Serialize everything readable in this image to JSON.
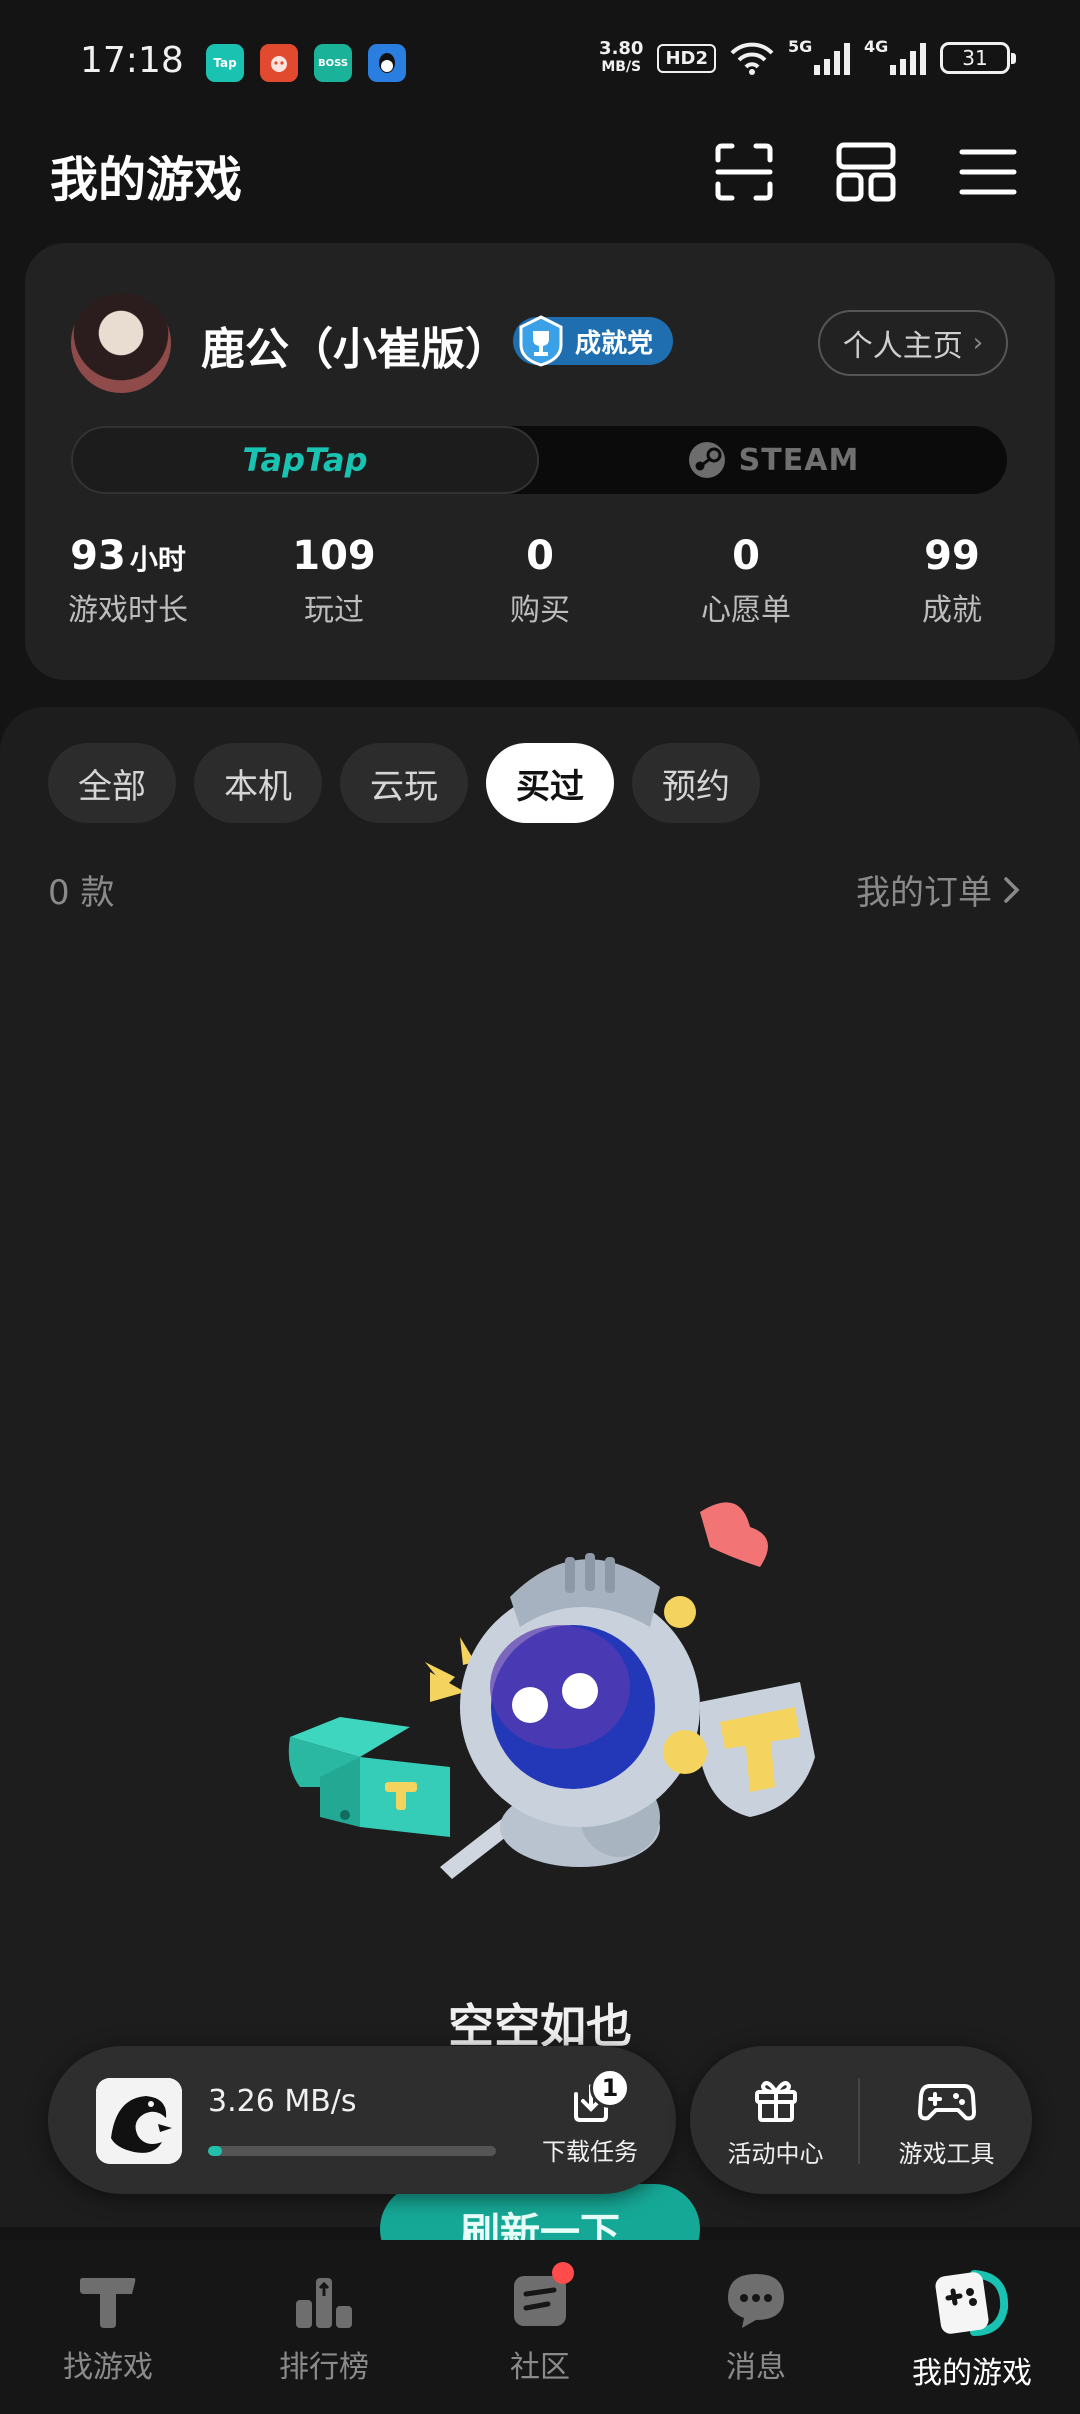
{
  "status_bar": {
    "time": "17:18",
    "apps": [
      {
        "name": "Tap",
        "color": "#19c2b1"
      },
      {
        "name": "",
        "color": "#e24a2f"
      },
      {
        "name": "BOSS",
        "color": "#1bb29a"
      },
      {
        "name": "",
        "color": "#2a7ee0"
      }
    ],
    "net_speed_value": "3.80",
    "net_speed_unit": "MB/S",
    "hd": "HD2",
    "signal_1": "5G",
    "signal_2": "4G",
    "battery": "31"
  },
  "header": {
    "title": "我的游戏",
    "icons": [
      "scan-icon",
      "grid-icon",
      "menu-icon"
    ]
  },
  "profile": {
    "username": "鹿公（小崔版）",
    "badge": "成就党",
    "homepage_button": "个人主页",
    "platforms": {
      "active": "TapTap",
      "inactive": "STEAM"
    },
    "stats": [
      {
        "value": "93",
        "unit": "小时",
        "label": "游戏时长"
      },
      {
        "value": "109",
        "unit": "",
        "label": "玩过"
      },
      {
        "value": "0",
        "unit": "",
        "label": "购买"
      },
      {
        "value": "0",
        "unit": "",
        "label": "心愿单"
      },
      {
        "value": "99",
        "unit": "",
        "label": "成就"
      }
    ]
  },
  "filters": {
    "tabs": [
      "全部",
      "本机",
      "云玩",
      "买过",
      "预约"
    ],
    "active": "买过"
  },
  "list": {
    "count": "0 款",
    "orders_link": "我的订单"
  },
  "empty_state": {
    "title": "空空如也",
    "refresh_button": "刷新一下"
  },
  "download": {
    "speed": "3.26 MB/s",
    "progress_fraction": 0.05,
    "task_label": "下载任务",
    "task_count": "1"
  },
  "tools": [
    {
      "label": "活动中心",
      "icon": "gift-icon"
    },
    {
      "label": "游戏工具",
      "icon": "gamepad-icon"
    }
  ],
  "bottom_nav": [
    {
      "label": "找游戏",
      "icon": "find-game-icon"
    },
    {
      "label": "排行榜",
      "icon": "ranking-icon"
    },
    {
      "label": "社区",
      "icon": "community-icon",
      "dot": true
    },
    {
      "label": "消息",
      "icon": "message-icon"
    },
    {
      "label": "我的游戏",
      "icon": "my-games-icon",
      "active": true
    }
  ],
  "colors": {
    "accent": "#19c2b1",
    "background": "#141414",
    "card": "#222222",
    "badge_blue": "#1f6fb0",
    "notification_red": "#ff4b4b"
  }
}
